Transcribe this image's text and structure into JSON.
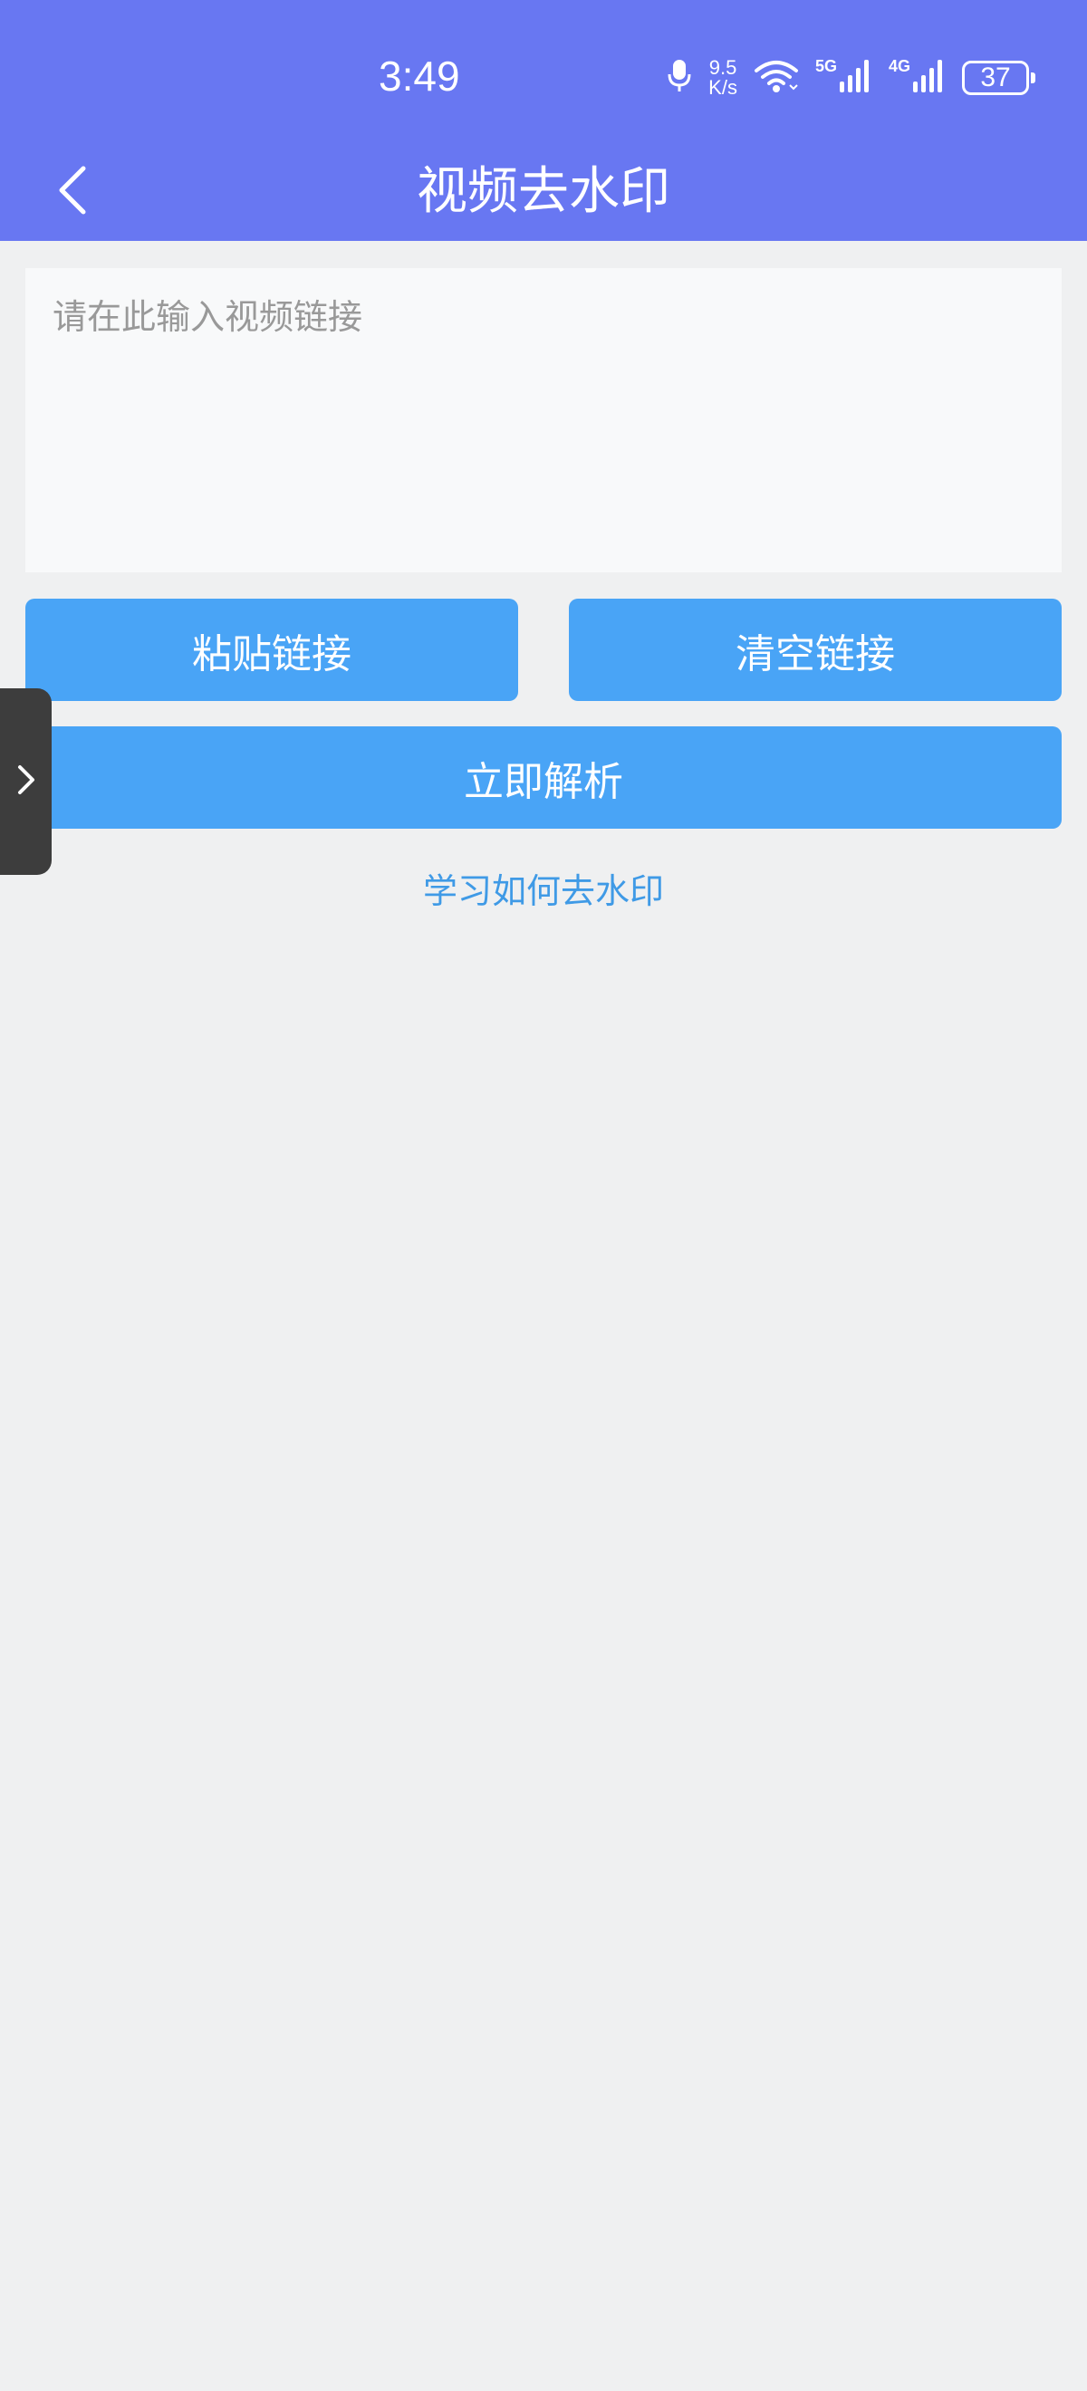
{
  "status_bar": {
    "time": "3:49",
    "speed_value": "9.5",
    "speed_unit": "K/s",
    "net1_label": "5G",
    "net2_label": "4G",
    "battery": "37",
    "icons": [
      "microphone-icon",
      "wifi-icon",
      "signal-icon",
      "battery-icon"
    ]
  },
  "header": {
    "title": "视频去水印",
    "background": "#6877f2",
    "back_icon": "chevron-left-icon"
  },
  "input": {
    "value": "",
    "placeholder": "请在此输入视频链接"
  },
  "buttons": {
    "paste_label": "粘贴链接",
    "clear_label": "清空链接",
    "parse_label": "立即解析",
    "color": "#49a4f6"
  },
  "learn_link": "学习如何去水印",
  "side_tab": {
    "icon": "chevron-right-icon"
  }
}
